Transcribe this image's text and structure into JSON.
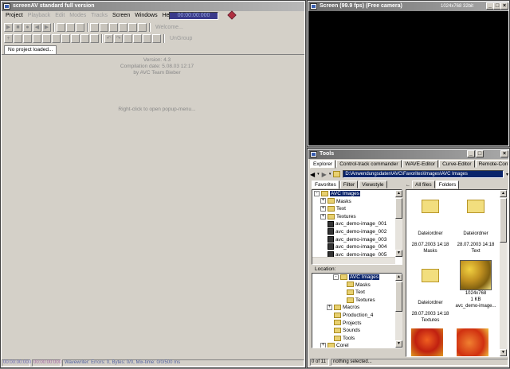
{
  "main_window": {
    "title": "screenAV standard full version",
    "menu": [
      {
        "label": "Project",
        "enabled": true
      },
      {
        "label": "Playback",
        "enabled": false
      },
      {
        "label": "Edit",
        "enabled": false
      },
      {
        "label": "Modes",
        "enabled": false
      },
      {
        "label": "Tracks",
        "enabled": false
      },
      {
        "label": "Screen",
        "enabled": true
      },
      {
        "label": "Windows",
        "enabled": true
      },
      {
        "label": "Help",
        "enabled": true
      }
    ],
    "timecode": "00:00:00:000",
    "welcome_label": "Welcome...",
    "ungroup_label": "UnGroup",
    "project_tab": "No project loaded...",
    "version": "Version: 4.3",
    "compilation_date": "Compilation date: 5.08.03 12:17",
    "by_line": "by AVC Team Bieber",
    "popup_hint": "Right-click to open popup-menu...",
    "status_time1": "00:00:00:000",
    "status_time2": "00:00:00:000",
    "status_text": "Wavewriter: Errors: 0, Bytes: 0/0, Mix-time: 0/0/500 ms"
  },
  "screen_window": {
    "title": "Screen (99.9 fps) (Free camera)",
    "resolution": "1024x768 32bit"
  },
  "tools_window": {
    "title": "Tools",
    "tabs": [
      "Explorer",
      "Control-track commander",
      "WAVE-Editor",
      "Curve-Editor",
      "Remote-Control-LF"
    ],
    "path": "D:\\Anwendungsdaten\\AVC\\Favorites\\Images\\AVC Images",
    "panel_tabs": [
      "Favorites",
      "Filter",
      "Viewstyle"
    ],
    "favorites_tree": [
      {
        "label": "AVC Images",
        "level": 0,
        "type": "folder",
        "exp": "-",
        "selected": true
      },
      {
        "label": "Masks",
        "level": 1,
        "type": "folder",
        "exp": "+"
      },
      {
        "label": "Text",
        "level": 1,
        "type": "folder",
        "exp": "+"
      },
      {
        "label": "Textures",
        "level": 1,
        "type": "folder",
        "exp": "+"
      },
      {
        "label": "avc_demo-image_001",
        "level": 1,
        "type": "image"
      },
      {
        "label": "avc_demo-image_002",
        "level": 1,
        "type": "image"
      },
      {
        "label": "avc_demo-image_003",
        "level": 1,
        "type": "image"
      },
      {
        "label": "avc_demo-image_004",
        "level": 1,
        "type": "image"
      },
      {
        "label": "avc_demo-image_005",
        "level": 1,
        "type": "image"
      }
    ],
    "location_label": "Location:",
    "location_tree": [
      {
        "label": "AVC Images",
        "level": 3,
        "type": "folder",
        "exp": "-",
        "selected": true
      },
      {
        "label": "Masks",
        "level": 4,
        "type": "folder"
      },
      {
        "label": "Text",
        "level": 4,
        "type": "folder"
      },
      {
        "label": "Textures",
        "level": 4,
        "type": "folder"
      },
      {
        "label": "Macros",
        "level": 2,
        "type": "folder",
        "exp": "+"
      },
      {
        "label": "Production_4",
        "level": 2,
        "type": "folder"
      },
      {
        "label": "Projects",
        "level": 2,
        "type": "folder"
      },
      {
        "label": "Sounds",
        "level": 2,
        "type": "folder"
      },
      {
        "label": "Tools",
        "level": 2,
        "type": "folder"
      },
      {
        "label": "Corel",
        "level": 1,
        "type": "folder",
        "exp": "+"
      }
    ],
    "view_tabs": [
      "All files",
      "Folders"
    ],
    "tiles": [
      {
        "kind": "folder",
        "type_label": "Dateiordner",
        "date": "28.07.2003 14:18",
        "name": "Masks"
      },
      {
        "kind": "folder",
        "type_label": "Dateiordner",
        "date": "28.07.2003 14:18",
        "name": "Text"
      },
      {
        "kind": "folder",
        "type_label": "Dateiordner",
        "date": "28.07.2003 14:18",
        "name": "Textures"
      },
      {
        "kind": "image",
        "size": "1024x768",
        "bytes": "1 KB",
        "name": "avc_demo-image..."
      }
    ],
    "status_count": "0 of 11",
    "status_text": "nothing selected..."
  }
}
